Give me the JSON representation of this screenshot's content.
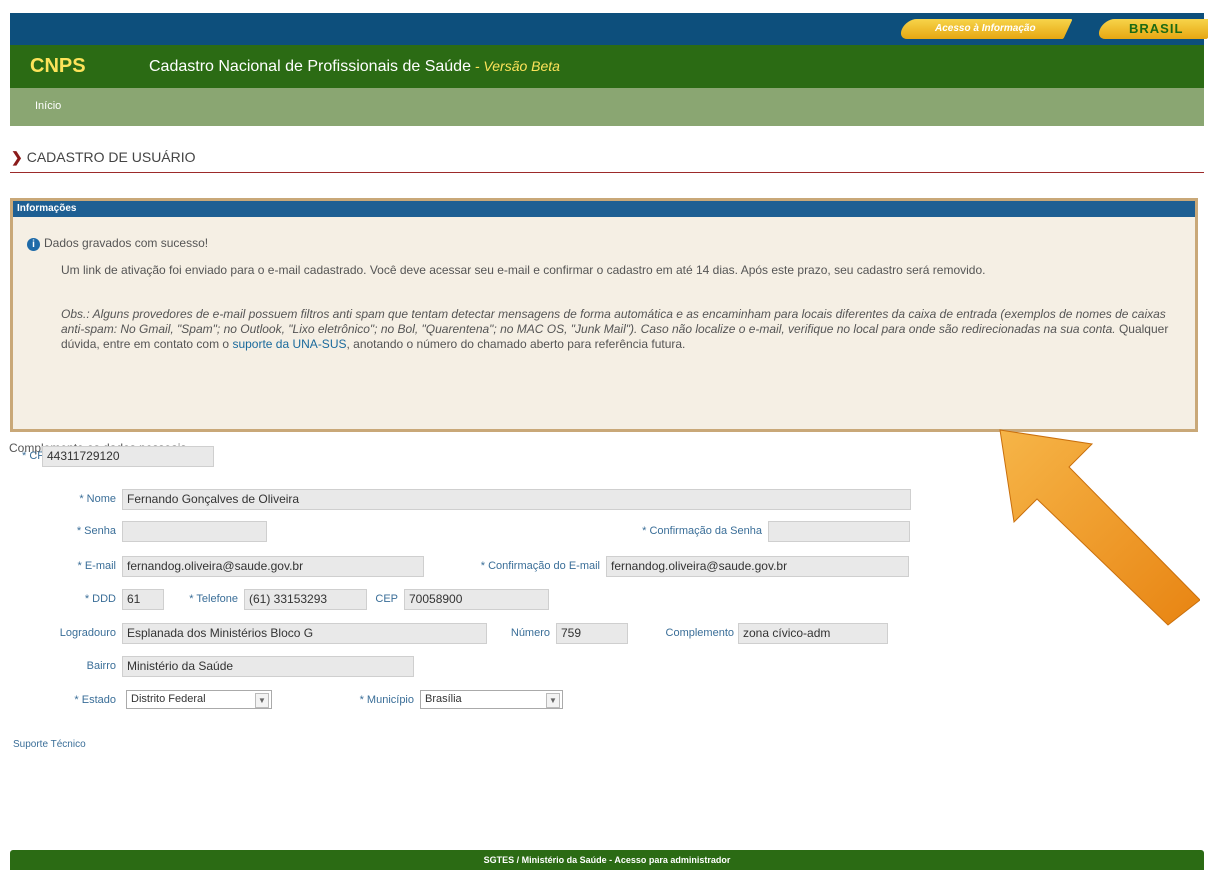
{
  "top_bar": {
    "acesso_label": "Acesso à Informação",
    "brasil_label": "BRASIL"
  },
  "header": {
    "logo": "CNPS",
    "title": "Cadastro Nacional de Profissionais de Saúde",
    "separator": " - ",
    "beta": "Versão Beta"
  },
  "nav": {
    "inicio": "Início"
  },
  "page": {
    "title": "CADASTRO DE USUÁRIO"
  },
  "info": {
    "header": "Informações",
    "success": "Dados gravados com sucesso!",
    "p1": "Um link de ativação foi enviado para o e-mail cadastrado. Você deve acessar seu e-mail e confirmar o cadastro em até 14 dias. Após este prazo, seu cadastro será removido.",
    "p2_italic": "Obs.: Alguns provedores de e-mail possuem filtros anti spam que tentam detectar mensagens de forma automática e as encaminham para locais diferentes da caixa de entrada (exemplos de nomes de caixas anti-spam: No Gmail, \"Spam\"; no Outlook, \"Lixo eletrônico\"; no Bol, \"Quarentena\"; no MAC OS, \"Junk Mail\"). Caso não localize o e-mail, verifique no local para onde são redirecionadas na sua conta.",
    "p2_normal": " Qualquer dúvida, entre em contato com o ",
    "p2_link": "suporte da UNA-SUS",
    "p2_end": ", anotando o número do chamado aberto para referência futura."
  },
  "form": {
    "subtitle": "Complemente os dados pessoais.",
    "cpf_label": "* CPF",
    "cpf_value": "44311729120",
    "nome_label": "* Nome",
    "nome_value": "Fernando Gonçalves de Oliveira",
    "senha_label": "* Senha",
    "senha_value": "",
    "conf_senha_label": "* Confirmação da Senha",
    "conf_senha_value": "",
    "email_label": "* E-mail",
    "email_value": "fernandog.oliveira@saude.gov.br",
    "conf_email_label": "* Confirmação do E-mail",
    "conf_email_value": "fernandog.oliveira@saude.gov.br",
    "ddd_label": "* DDD",
    "ddd_value": "61",
    "telefone_label": "* Telefone",
    "telefone_value": "(61) 33153293",
    "cep_label": "CEP",
    "cep_value": "70058900",
    "logradouro_label": "Logradouro",
    "logradouro_value": "Esplanada dos Ministérios Bloco G",
    "numero_label": "Número",
    "numero_value": "759",
    "complemento_label": "Complemento",
    "complemento_value": "zona cívico-adm",
    "bairro_label": "Bairro",
    "bairro_value": "Ministério da Saúde",
    "estado_label": "* Estado",
    "estado_value": "Distrito Federal",
    "municipio_label": "* Município",
    "municipio_value": "Brasília"
  },
  "support_link": "Suporte Técnico",
  "footer": "SGTES / Ministério da Saúde - Acesso para administrador",
  "colors": {
    "header_green": "#2b6b14",
    "nav_green": "#8aa672",
    "top_blue": "#0d4f7c",
    "arrow_orange": "#f09a1e"
  }
}
